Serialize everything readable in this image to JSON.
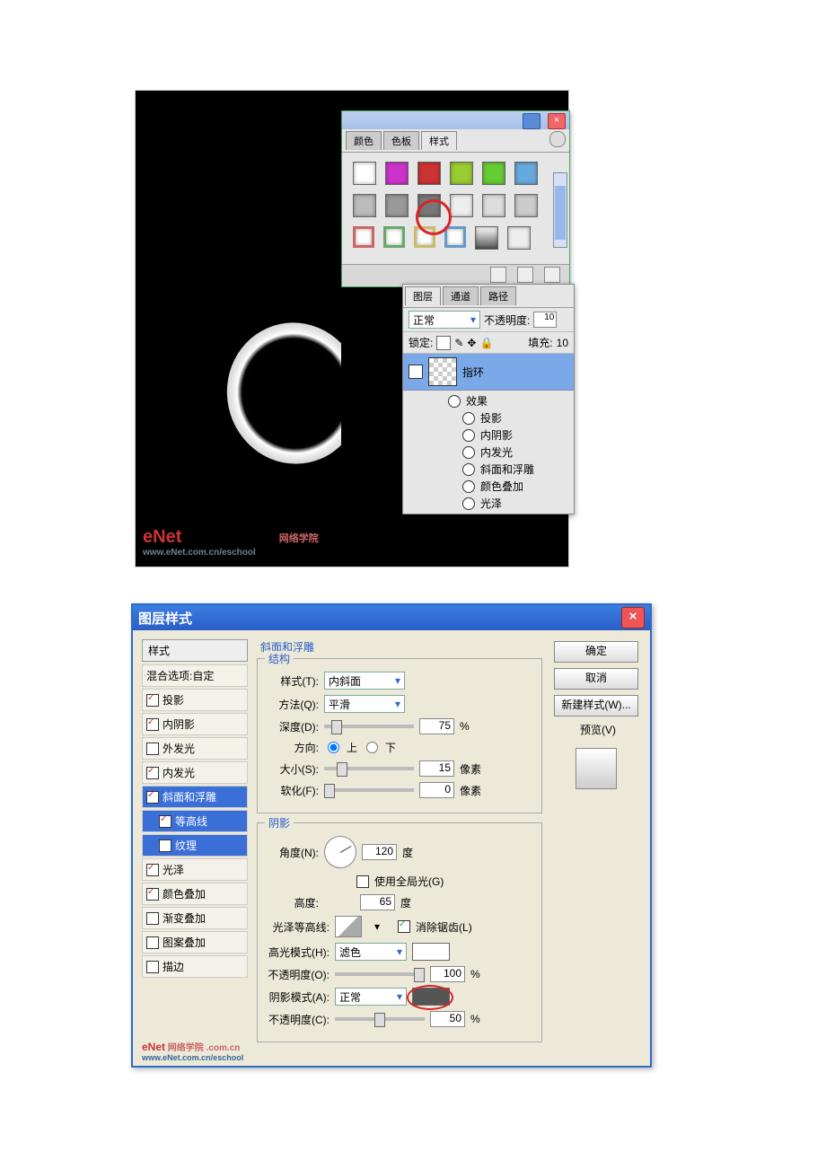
{
  "top": {
    "palette": {
      "tabs": [
        "颜色",
        "色板",
        "样式"
      ],
      "active_tab": "样式",
      "rows": [
        [
          "#ffffff",
          "#c33cc3",
          "#cc3333",
          "#99cc33",
          "#66cc33",
          "#66aadd"
        ],
        [
          "#888888",
          "#777777",
          "#555555",
          "#eeeeee",
          "#dddddd",
          "#cccccc"
        ],
        [
          "#cc6666",
          "#66aa66",
          "#ccbb66",
          "#6699cc",
          "#999999",
          "#eeeeee"
        ]
      ]
    },
    "layers": {
      "tabs": [
        "图层",
        "通道",
        "路径"
      ],
      "active_tab": "图层",
      "blend_mode": "正常",
      "opacity_label": "不透明度:",
      "opacity_value": "10",
      "lock_label": "锁定:",
      "fill_label": "填充:",
      "fill_value": "10",
      "layer_name": "指环",
      "fx_header": "效果",
      "effects": [
        "投影",
        "内阴影",
        "内发光",
        "斜面和浮雕",
        "颜色叠加",
        "光泽"
      ]
    },
    "logo_main": "eNet",
    "logo_sub": "www.eNet.com.cn/eschool",
    "logo_side": "网络学院"
  },
  "dialog": {
    "title": "图层样式",
    "left_header": "样式",
    "blend_options": "混合选项:自定",
    "styles": [
      {
        "label": "投影",
        "checked": true
      },
      {
        "label": "内阴影",
        "checked": true
      },
      {
        "label": "外发光",
        "checked": false
      },
      {
        "label": "内发光",
        "checked": true
      },
      {
        "label": "斜面和浮雕",
        "checked": true,
        "selected": true
      },
      {
        "label": "等高线",
        "checked": true,
        "sub": true,
        "selected": true
      },
      {
        "label": "纹理",
        "checked": false,
        "sub": true,
        "selected": true
      },
      {
        "label": "光泽",
        "checked": true
      },
      {
        "label": "颜色叠加",
        "checked": true
      },
      {
        "label": "渐变叠加",
        "checked": false
      },
      {
        "label": "图案叠加",
        "checked": false
      },
      {
        "label": "描边",
        "checked": false
      }
    ],
    "section_top": "斜面和浮雕",
    "structure": {
      "group": "结构",
      "style_label": "样式(T):",
      "style_value": "内斜面",
      "technique_label": "方法(Q):",
      "technique_value": "平滑",
      "depth_label": "深度(D):",
      "depth_value": "75",
      "depth_unit": "%",
      "direction_label": "方向:",
      "dir_up": "上",
      "dir_down": "下",
      "size_label": "大小(S):",
      "size_value": "15",
      "size_unit": "像素",
      "soften_label": "软化(F):",
      "soften_value": "0",
      "soften_unit": "像素"
    },
    "shading": {
      "group": "阴影",
      "angle_label": "角度(N):",
      "angle_value": "120",
      "angle_unit": "度",
      "global_label": "使用全局光(G)",
      "altitude_label": "高度:",
      "altitude_value": "65",
      "altitude_unit": "度",
      "contour_label": "光泽等高线:",
      "antialias_label": "消除锯齿(L)",
      "highlight_mode_label": "高光模式(H):",
      "highlight_mode_value": "滤色",
      "highlight_color": "#ffffff",
      "opacity_label": "不透明度(O):",
      "opacity_value": "100",
      "opacity_unit": "%",
      "shadow_mode_label": "阴影模式(A):",
      "shadow_mode_value": "正常",
      "shadow_color": "#555555",
      "shadow_opacity_label": "不透明度(C):",
      "shadow_opacity_value": "50",
      "shadow_opacity_unit": "%"
    },
    "right": {
      "ok": "确定",
      "cancel": "取消",
      "new_style": "新建样式(W)...",
      "preview": "预览(V)"
    }
  }
}
